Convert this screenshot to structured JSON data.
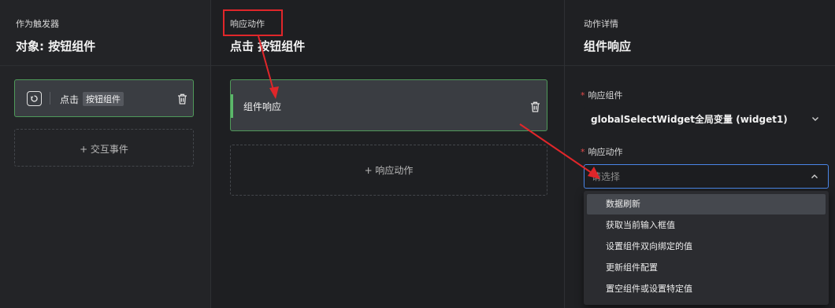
{
  "trigger_panel": {
    "subtitle": "作为触发器",
    "title": "对象: 按钮组件",
    "trigger_item": {
      "action": "点击",
      "tag": "按钮组件"
    },
    "add_event_label": "+ 交互事件"
  },
  "action_panel": {
    "subtitle": "响应动作",
    "title": "点击 按钮组件",
    "action_item": {
      "label": "组件响应"
    },
    "add_action_label": "+ 响应动作"
  },
  "detail_panel": {
    "subtitle": "动作详情",
    "title": "组件响应",
    "required_mark": "*",
    "widget_field": {
      "label": "响应组件",
      "value": "globalSelectWidget全局变量 (widget1)"
    },
    "action_field": {
      "label": "响应动作",
      "placeholder": "请选择"
    },
    "options": [
      "数据刷新",
      "获取当前输入框值",
      "设置组件双向绑定的值",
      "更新组件配置",
      "置空组件或设置特定值"
    ],
    "active_option_index": 0
  },
  "annotation": {
    "highlight_color": "#e0262a"
  },
  "colors": {
    "card_border": "#4f9a5a",
    "accent_green": "#5bb86a",
    "focus_blue": "#4a86e8"
  },
  "icons": {
    "trigger": "power-cycle-icon",
    "delete": "trash-icon",
    "expand": "chevron-down-icon",
    "collapse": "chevron-up-icon"
  }
}
